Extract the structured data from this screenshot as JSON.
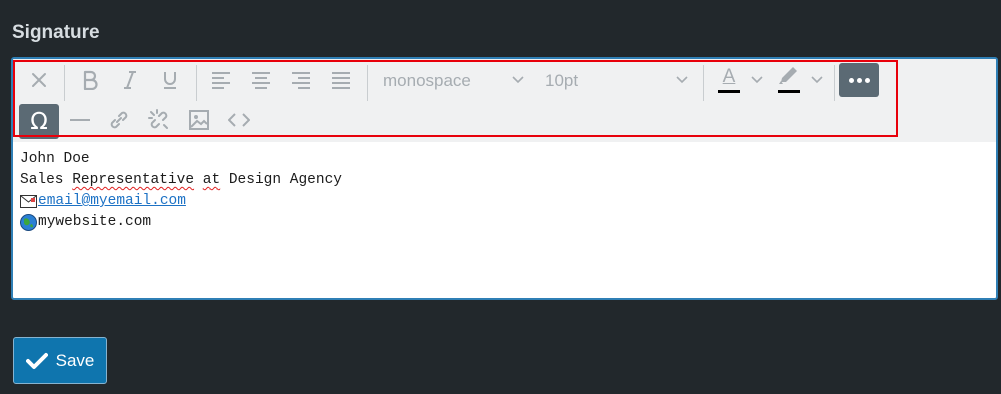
{
  "section": {
    "title": "Signature"
  },
  "toolbar": {
    "font_family": "monospace",
    "font_size": "10pt",
    "text_color_letter": "A",
    "buttons": [
      "clear-formatting",
      "bold",
      "italic",
      "underline",
      "align-left",
      "align-center",
      "align-right",
      "justify",
      "text-color",
      "highlight-color",
      "more",
      "special-character",
      "horizontal-line",
      "link",
      "unlink",
      "image",
      "source-code"
    ],
    "active_color": "#5b6a74",
    "highlight_outline_color": "#e8000b"
  },
  "signature": {
    "name": "John Doe",
    "title_prefix": "Sales ",
    "title_word": "Representative",
    "title_space": " ",
    "title_at": "at",
    "title_suffix": " Design Agency",
    "email": "email@myemail.com",
    "website": "mywebsite.com"
  },
  "actions": {
    "save_label": "Save"
  },
  "colors": {
    "page_background": "#22282c",
    "editor_border": "#2f7fb5",
    "save_button": "#0f75ae",
    "link": "#1d72c5"
  }
}
